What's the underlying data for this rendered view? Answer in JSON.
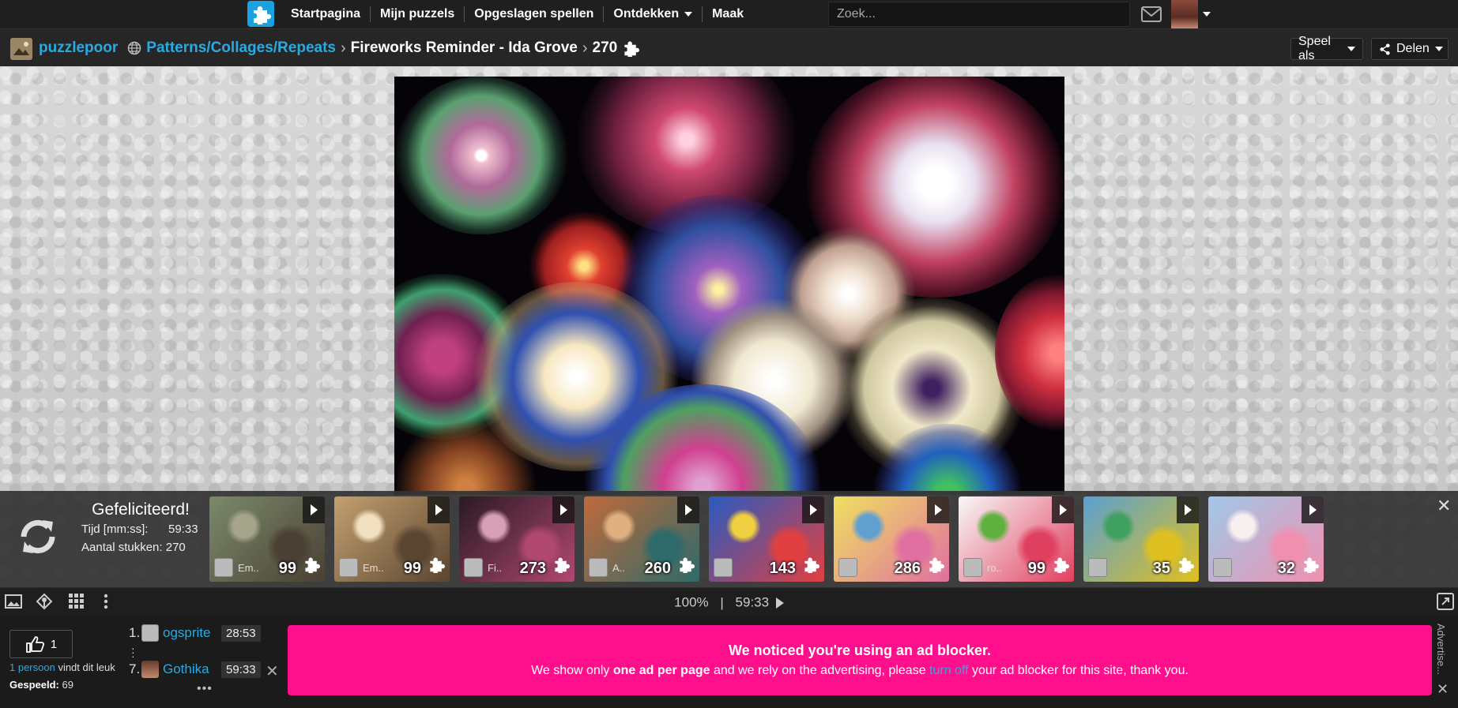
{
  "nav": {
    "items": [
      {
        "label": "Startpagina"
      },
      {
        "label": "Mijn puzzels"
      },
      {
        "label": "Opgeslagen spellen"
      },
      {
        "label": "Ontdekken",
        "dropdown": true
      },
      {
        "label": "Maak"
      }
    ],
    "search_placeholder": "Zoek...",
    "mail_icon": "envelope-icon",
    "logo_icon": "puzzle-piece-icon"
  },
  "breadcrumb": {
    "user": "puzzlepoor",
    "category_icon": "globe-icon",
    "category": "Patterns/Collages/Repeats",
    "title": "Fireworks Reminder - Ida Grove",
    "pieces": "270",
    "play_as": "Speel als",
    "share": "Delen"
  },
  "congrats": {
    "title": "Gefeliciteerd!",
    "time_label": "Tijd [mm:ss]:",
    "time_value": "59:33",
    "pieces_label": "Aantal stukken: 270"
  },
  "thumbnails": [
    {
      "user": "Em..",
      "count": "99",
      "colors": [
        "#7b8a6a",
        "#4a4034",
        "#a6a58c"
      ]
    },
    {
      "user": "Em..",
      "count": "99",
      "colors": [
        "#c4a070",
        "#5a4530",
        "#f0e0c0"
      ]
    },
    {
      "user": "Fi..",
      "count": "273",
      "colors": [
        "#2a1a24",
        "#b04870",
        "#d8a0b8"
      ]
    },
    {
      "user": "A..",
      "count": "260",
      "colors": [
        "#c06a3a",
        "#2e6a6a",
        "#e0b080"
      ]
    },
    {
      "user": "",
      "count": "143",
      "colors": [
        "#2a5ac0",
        "#e04040",
        "#f0d040"
      ]
    },
    {
      "user": "",
      "count": "286",
      "colors": [
        "#f0e060",
        "#e070a0",
        "#60a0d0"
      ]
    },
    {
      "user": "ro..",
      "count": "99",
      "colors": [
        "#f8f8f8",
        "#e04060",
        "#60b040"
      ]
    },
    {
      "user": "",
      "count": "35",
      "colors": [
        "#5aa0d0",
        "#e0c020",
        "#40a060"
      ]
    },
    {
      "user": "",
      "count": "32",
      "colors": [
        "#a0c8e8",
        "#f090b0",
        "#f8f0f0"
      ]
    }
  ],
  "toolbar": {
    "zoom": "100%",
    "separator": "|",
    "timer": "59:33"
  },
  "likes": {
    "count": "1",
    "people_link": "1 persoon",
    "suffix": " vindt dit leuk",
    "played_label": "Gespeeld:",
    "played_value": "69"
  },
  "scores": [
    {
      "rank": "1.",
      "name": "ogsprite",
      "time": "28:53"
    },
    {
      "rank": "7.",
      "name": "Gothika",
      "time": "59:33"
    }
  ],
  "more": "•••",
  "ad": {
    "title": "We noticed you're using an ad blocker.",
    "body_1": "We show only ",
    "body_bold": "one ad per page",
    "body_2": " and we rely on the advertising, please ",
    "body_link": "turn off",
    "body_3": " your ad blocker for this site, thank you.",
    "advertise": "Advertise..."
  }
}
